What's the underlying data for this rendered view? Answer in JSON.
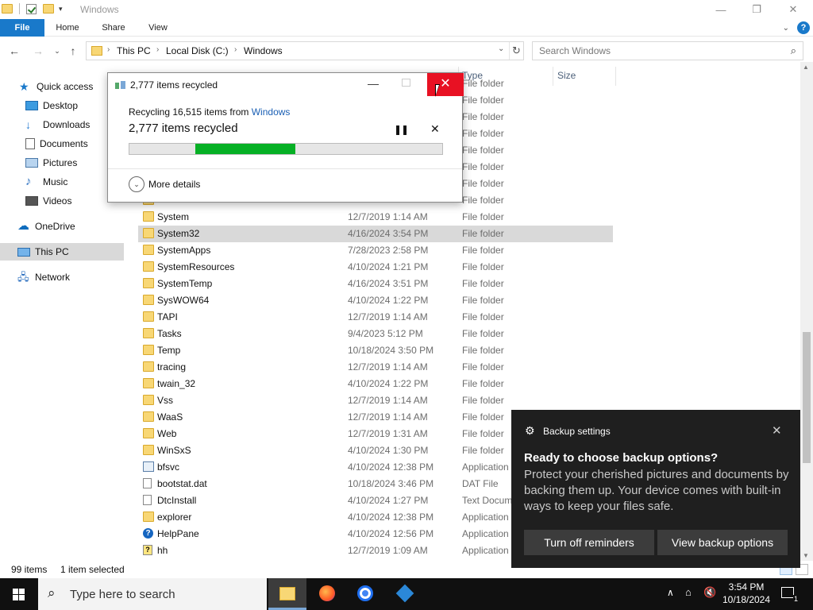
{
  "window": {
    "title": "Windows"
  },
  "ribbon": {
    "tabs": [
      "File",
      "Home",
      "Share",
      "View"
    ]
  },
  "address": {
    "crumbs": [
      "This PC",
      "Local Disk (C:)",
      "Windows"
    ],
    "search_placeholder": "Search Windows"
  },
  "navpane": {
    "quick_access": "Quick access",
    "items": [
      "Desktop",
      "Downloads",
      "Documents",
      "Pictures",
      "Music",
      "Videos"
    ],
    "onedrive": "OneDrive",
    "this_pc": "This PC",
    "network": "Network"
  },
  "columns": {
    "type": "Type",
    "size": "Size"
  },
  "files": [
    {
      "name": "",
      "date": "",
      "type": "File folder"
    },
    {
      "name": "",
      "date": "",
      "type": "File folder"
    },
    {
      "name": "",
      "date": "",
      "type": "File folder"
    },
    {
      "name": "",
      "date": "",
      "type": "File folder"
    },
    {
      "name": "",
      "date": "",
      "type": "File folder"
    },
    {
      "name": "",
      "date": "",
      "type": "File folder"
    },
    {
      "name": "",
      "date": "",
      "type": "File folder"
    },
    {
      "name": "",
      "date": "",
      "type": "File folder"
    },
    {
      "name": "System",
      "date": "12/7/2019 1:14 AM",
      "type": "File folder"
    },
    {
      "name": "System32",
      "date": "4/16/2024 3:54 PM",
      "type": "File folder",
      "selected": true
    },
    {
      "name": "SystemApps",
      "date": "7/28/2023 2:58 PM",
      "type": "File folder"
    },
    {
      "name": "SystemResources",
      "date": "4/10/2024 1:21 PM",
      "type": "File folder"
    },
    {
      "name": "SystemTemp",
      "date": "4/16/2024 3:51 PM",
      "type": "File folder"
    },
    {
      "name": "SysWOW64",
      "date": "4/10/2024 1:22 PM",
      "type": "File folder"
    },
    {
      "name": "TAPI",
      "date": "12/7/2019 1:14 AM",
      "type": "File folder"
    },
    {
      "name": "Tasks",
      "date": "9/4/2023 5:12 PM",
      "type": "File folder"
    },
    {
      "name": "Temp",
      "date": "10/18/2024 3:50 PM",
      "type": "File folder"
    },
    {
      "name": "tracing",
      "date": "12/7/2019 1:14 AM",
      "type": "File folder"
    },
    {
      "name": "twain_32",
      "date": "4/10/2024 1:22 PM",
      "type": "File folder"
    },
    {
      "name": "Vss",
      "date": "12/7/2019 1:14 AM",
      "type": "File folder"
    },
    {
      "name": "WaaS",
      "date": "12/7/2019 1:14 AM",
      "type": "File folder"
    },
    {
      "name": "Web",
      "date": "12/7/2019 1:31 AM",
      "type": "File folder"
    },
    {
      "name": "WinSxS",
      "date": "4/10/2024 1:30 PM",
      "type": "File folder"
    },
    {
      "name": "bfsvc",
      "date": "4/10/2024 12:38 PM",
      "type": "Application",
      "icon": "app"
    },
    {
      "name": "bootstat.dat",
      "date": "10/18/2024 3:46 PM",
      "type": "DAT File",
      "icon": "file"
    },
    {
      "name": "DtcInstall",
      "date": "4/10/2024 1:27 PM",
      "type": "Text Docum",
      "icon": "file"
    },
    {
      "name": "explorer",
      "date": "4/10/2024 12:38 PM",
      "type": "Application",
      "icon": "folder"
    },
    {
      "name": "HelpPane",
      "date": "4/10/2024 12:56 PM",
      "type": "Application",
      "icon": "help"
    },
    {
      "name": "hh",
      "date": "12/7/2019 1:09 AM",
      "type": "Application",
      "icon": "hh"
    }
  ],
  "status": {
    "count": "99 items",
    "selection": "1 item selected"
  },
  "dialog": {
    "title": "2,777 items recycled",
    "line1_prefix": "Recycling 16,515 items from ",
    "line1_link": "Windows",
    "line2": "2,777 items recycled",
    "progress_fill_start": 0.21,
    "progress_fill_end": 0.53,
    "more_details": "More details"
  },
  "toast": {
    "app": "Backup settings",
    "heading": "Ready to choose backup options?",
    "body": "Protect your cherished pictures and documents by backing them up. Your device comes with built-in ways to keep your files safe.",
    "btn_off": "Turn off reminders",
    "btn_view": "View backup options"
  },
  "taskbar": {
    "search_placeholder": "Type here to search",
    "time": "3:54 PM",
    "date": "10/18/2024",
    "notification_count": "1"
  },
  "colors": {
    "accent": "#1979ca",
    "progress": "#06b025",
    "close_red": "#e81123",
    "toast_bg": "#1f1f1f"
  }
}
